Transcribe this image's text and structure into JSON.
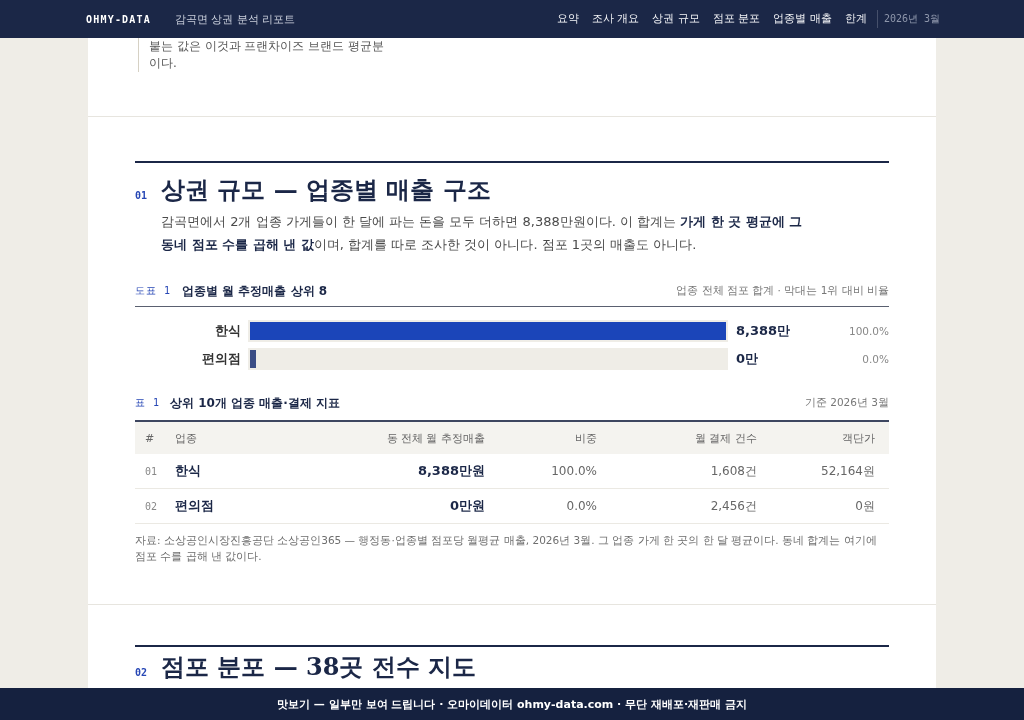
{
  "nav": {
    "brand": "OHMY-DATA",
    "report_title": "감곡면 상권 분석 리포트",
    "links": [
      {
        "label": "요약",
        "selected": false
      },
      {
        "label": "조사 개요",
        "selected": false
      },
      {
        "label": "상권 규모",
        "selected": false
      },
      {
        "label": "점포 분포",
        "selected": false
      },
      {
        "label": "업종별 매출",
        "selected": false
      },
      {
        "label": "한계",
        "selected": false
      }
    ],
    "date": "2026년 3월"
  },
  "callout": {
    "text": "붙는 값은 이것과 프랜차이즈 브랜드 평균분이다."
  },
  "section": {
    "number": "01",
    "title": "상권 규모 — 업종별 매출 구조",
    "lead": "감곡면에서 2개 업종 가게들이 한 달에 파는 돈을 모두 더하면 8,388만원이다. 이 합계는 **가게 한 곳 평균에 그 동네 점포 수를 곱해 낸 값**이며, 합계를 따로 조사한 것이 아니다. 점포 1곳의 매출도 아니다."
  },
  "figure": {
    "label": "도표 1",
    "title": "업종별 월 추정매출 상위 8",
    "note": "업종 전체 점포 합계 · 막대는 1위 대비 비율",
    "bars": [
      {
        "label": "한식",
        "level": 1,
        "color": "#1b45b9",
        "value": "8,388만",
        "share": "100.0%"
      },
      {
        "label": "편의점",
        "level": 0.012,
        "color": "#3a4d85",
        "value": "0만",
        "share": "0.0%"
      }
    ]
  },
  "table": {
    "label": "표 1",
    "title": "상위 10개 업종 매출·결제 지표",
    "note": "기준 2026년 3월",
    "columns": [
      "#",
      "업종",
      "동 전체 월 추정매출",
      "비중",
      "월 결제 건수",
      "객단가"
    ],
    "rows": [
      [
        "01",
        "한식",
        "8,388만원",
        "100.0%",
        "1,608건",
        "52,164원"
      ],
      [
        "02",
        "편의점",
        "0만원",
        "0.0%",
        "2,456건",
        "0원"
      ]
    ],
    "source": "자료: 소상공인시장진흥공단 소상공인365 — 행정동·업종별 점포당 월평균 매출, 2026년 3월. 그 업종 가게 한 곳의 한 달 평균이다. 동네 합계는 여기에 점포 수를 곱해 낸 값이다."
  },
  "next_section": {
    "number": "02",
    "title": "점포 분포 — 38곳 전수 지도"
  },
  "banner": {
    "text": "맛보기 — 일부만 보여 드립니다 · 오마이데이터 ohmy-data.com · 무단 재배포·재판매 금지"
  }
}
